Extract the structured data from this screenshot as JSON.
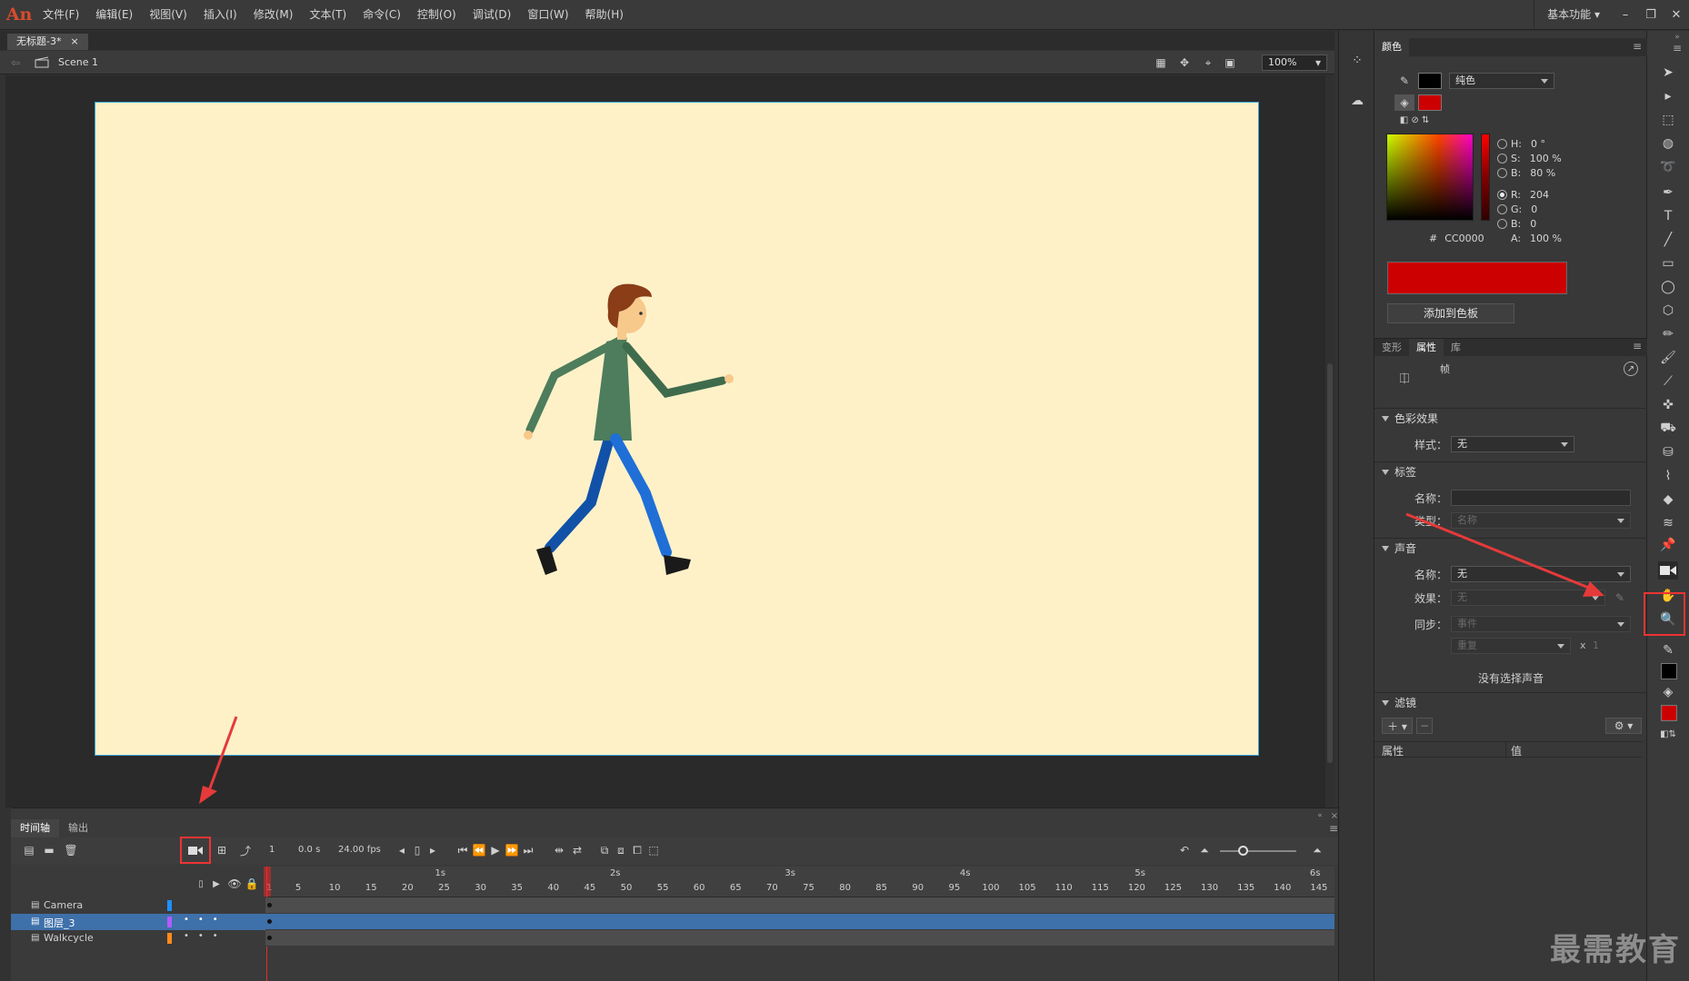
{
  "app": {
    "logo": "An"
  },
  "menu": [
    "文件(F)",
    "编辑(E)",
    "视图(V)",
    "插入(I)",
    "修改(M)",
    "文本(T)",
    "命令(C)",
    "控制(O)",
    "调试(D)",
    "窗口(W)",
    "帮助(H)"
  ],
  "workspace": "基本功能",
  "window_controls": {
    "minimize": "–",
    "restore": "❐",
    "close": "✕"
  },
  "document": {
    "tab_title": "无标题-3*",
    "tab_close": "×",
    "scene": "Scene 1",
    "zoom": "100%"
  },
  "timeline": {
    "tabs": [
      "时间轴",
      "输出"
    ],
    "current_frame": "1",
    "time": "0.0 s",
    "fps": "24.00 fps",
    "ruler_seconds": [
      "1s",
      "2s",
      "3s",
      "4s",
      "5s",
      "6s"
    ],
    "ruler_frames": [
      "1",
      "5",
      "10",
      "15",
      "20",
      "25",
      "30",
      "35",
      "40",
      "45",
      "50",
      "55",
      "60",
      "65",
      "70",
      "75",
      "80",
      "85",
      "90",
      "95",
      "100",
      "105",
      "110",
      "115",
      "120",
      "125",
      "130",
      "135",
      "140",
      "145"
    ],
    "layers": [
      {
        "name": "Camera",
        "color": "#1e90ff",
        "selected": false
      },
      {
        "name": "图层_3",
        "color": "#b05cff",
        "selected": true
      },
      {
        "name": "Walkcycle",
        "color": "#ff8c1a",
        "selected": false
      }
    ]
  },
  "color_panel": {
    "tab": "颜色",
    "fill_type": "纯色",
    "stroke_color": "#000000",
    "fill_color": "#cc0000",
    "H": "0 °",
    "S": "100 %",
    "B": "80 %",
    "R": "204",
    "G": "0",
    "Bv": "0",
    "hex_label": "#",
    "hex": "CC0000",
    "A": "100 %",
    "add_swatch": "添加到色板"
  },
  "properties": {
    "tabs": [
      "变形",
      "属性",
      "库"
    ],
    "frame_label": "帧",
    "color_effect": {
      "title": "色彩效果",
      "style_label": "样式：",
      "style_value": "无"
    },
    "label": {
      "title": "标签",
      "name_label": "名称：",
      "type_label": "类型：",
      "type_value": "名称"
    },
    "sound": {
      "title": "声音",
      "name_label": "名称：",
      "name_value": "无",
      "effect_label": "效果：",
      "effect_value": "无",
      "sync_label": "同步：",
      "sync_value": "事件",
      "repeat_value": "重复",
      "x_label": "x",
      "count": "1",
      "no_sound": "没有选择声音"
    },
    "filters": {
      "title": "滤镜",
      "col_prop": "属性",
      "col_value": "值"
    }
  },
  "watermark": "最需教育"
}
